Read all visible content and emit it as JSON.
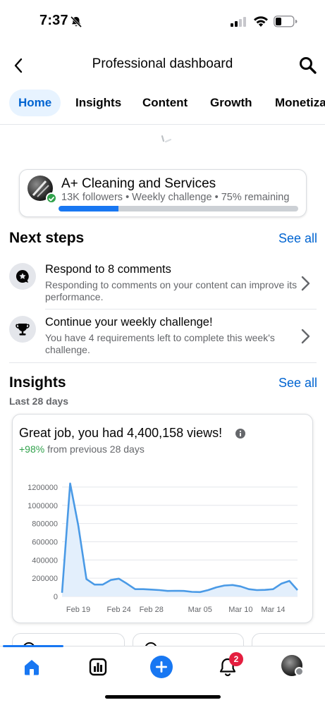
{
  "status_bar": {
    "time": "7:37"
  },
  "header": {
    "title": "Professional dashboard"
  },
  "tabs": [
    {
      "label": "Home",
      "active": true
    },
    {
      "label": "Insights",
      "active": false
    },
    {
      "label": "Content",
      "active": false
    },
    {
      "label": "Growth",
      "active": false
    },
    {
      "label": "Monetiza",
      "active": false
    }
  ],
  "profile_card": {
    "name": "A+ Cleaning and Services",
    "meta": "13K followers • Weekly challenge • 75% remaining",
    "challenge_progress": 0.25
  },
  "next_steps": {
    "title": "Next steps",
    "see_all": "See all",
    "items": [
      {
        "title": "Respond to 8 comments",
        "description": "Responding to comments on your content can improve its performance.",
        "icon": "comment-star-icon"
      },
      {
        "title": "Continue your weekly challenge!",
        "description": "You have 4 requirements left to complete this week's challenge.",
        "icon": "trophy-icon"
      }
    ]
  },
  "insights": {
    "title": "Insights",
    "see_all": "See all",
    "period": "Last 28 days",
    "headline": "Great job, you had 4,400,158 views!",
    "change_pct": "+98%",
    "change_text": " from previous 28 days"
  },
  "chart_data": {
    "type": "area",
    "x": [
      "Feb 17",
      "Feb 18",
      "Feb 19",
      "Feb 20",
      "Feb 21",
      "Feb 22",
      "Feb 23",
      "Feb 24",
      "Feb 25",
      "Feb 26",
      "Feb 27",
      "Feb 28",
      "Feb 29",
      "Mar 01",
      "Mar 02",
      "Mar 03",
      "Mar 04",
      "Mar 05",
      "Mar 06",
      "Mar 07",
      "Mar 08",
      "Mar 09",
      "Mar 10",
      "Mar 11",
      "Mar 12",
      "Mar 13",
      "Mar 14",
      "Mar 15",
      "Mar 16",
      "Mar 17"
    ],
    "values": [
      40000,
      1240000,
      780000,
      190000,
      130000,
      130000,
      180000,
      195000,
      140000,
      80000,
      80000,
      75000,
      70000,
      60000,
      62000,
      60000,
      50000,
      48000,
      70000,
      100000,
      120000,
      125000,
      110000,
      80000,
      70000,
      72000,
      80000,
      140000,
      170000,
      70000
    ],
    "xticks": [
      "Feb 19",
      "Feb 24",
      "Feb 28",
      "Mar 05",
      "Mar 10",
      "Mar 14"
    ],
    "yticks": [
      0,
      200000,
      400000,
      600000,
      800000,
      1000000,
      1200000
    ],
    "ylim": [
      0,
      1300000
    ],
    "color": "#4a9ae6",
    "fill": "#e3effc",
    "grid": true
  },
  "bottom_tabs": {
    "notifications_count": "2"
  },
  "colors": {
    "accent": "#1877f2",
    "link": "#0064d1",
    "positive": "#31a24c",
    "badge": "#e41e3f"
  }
}
